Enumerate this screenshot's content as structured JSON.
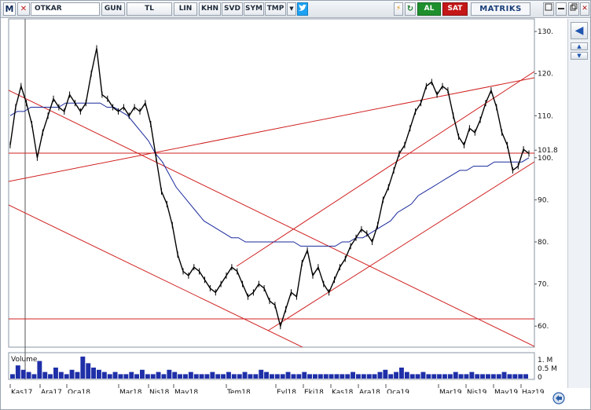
{
  "toolbar": {
    "logo": "M",
    "symbol": "OTKAR",
    "period": "GUN",
    "currency": "TL",
    "scale": "LIN",
    "khn": "KHN",
    "svd": "SVD",
    "sym": "SYM",
    "tmp": "TMP",
    "dropdown": "▼",
    "al": "AL",
    "sat": "SAT",
    "brand": "MATRIKS",
    "close": "✕"
  },
  "right_strip": {
    "up": "▲",
    "down": "▼",
    "arrow": "◀"
  },
  "chart_data": {
    "type": "line",
    "price_axis": {
      "labels": [
        "130.",
        "120.",
        "110.",
        "101.8",
        "100.",
        "90.",
        "80.",
        "70.",
        "60."
      ],
      "range": [
        55,
        133
      ]
    },
    "volume_axis": {
      "title": "Volume",
      "labels": [
        "1. M",
        "0.5 M",
        "0"
      ]
    },
    "x_axis": {
      "labels": [
        "Kas17",
        "Ara17",
        "Oca18",
        "Mar18",
        "Nis18",
        "May18",
        "Tem18",
        "Eyl18",
        "Eki18",
        "Kas18",
        "Ara18",
        "Oca19",
        "Mar19",
        "Nis19",
        "May19",
        "Haz19"
      ]
    },
    "last_price": 101.8,
    "price_series": [
      103,
      112,
      117,
      113,
      108,
      100,
      106,
      110,
      114,
      112,
      111,
      115,
      113,
      111,
      113,
      120,
      126,
      115,
      114,
      112,
      111,
      112,
      110,
      112,
      111,
      113,
      108,
      100,
      92,
      89,
      84,
      77,
      73,
      72,
      74,
      73,
      71,
      69,
      68,
      70,
      72,
      74,
      73,
      70,
      67,
      68,
      70,
      69,
      66,
      65,
      60,
      64,
      68,
      67,
      75,
      78,
      72,
      74,
      70,
      68,
      71,
      74,
      76,
      79,
      81,
      83,
      82,
      80,
      84,
      90,
      93,
      97,
      101,
      103,
      107,
      111,
      113,
      117,
      118,
      115,
      117,
      116,
      110,
      105,
      103,
      107,
      106,
      109,
      113,
      116,
      112,
      106,
      103,
      97,
      98,
      102,
      101
    ],
    "ma_series": [
      110,
      111,
      111,
      112,
      112,
      112,
      112,
      112,
      113,
      113,
      113,
      113,
      113,
      113,
      112,
      112,
      111,
      110,
      108,
      106,
      104,
      101,
      99,
      96,
      93,
      91,
      89,
      87,
      85,
      84,
      83,
      82,
      81,
      81,
      80,
      80,
      80,
      80,
      80,
      80,
      80,
      80,
      79,
      79,
      79,
      79,
      79,
      79,
      80,
      80,
      81,
      81,
      82,
      83,
      84,
      85,
      87,
      88,
      89,
      91,
      92,
      93,
      94,
      95,
      96,
      97,
      97,
      98,
      98,
      98,
      99,
      99,
      99,
      99,
      99,
      100
    ],
    "volume_series": [
      0.2,
      0.6,
      0.4,
      0.3,
      0.2,
      0.8,
      0.3,
      0.2,
      0.5,
      0.3,
      0.2,
      0.4,
      0.3,
      1.0,
      0.7,
      0.5,
      0.4,
      0.3,
      0.2,
      0.3,
      0.2,
      0.2,
      0.3,
      0.2,
      0.4,
      0.2,
      0.2,
      0.3,
      0.2,
      0.4,
      0.3,
      0.2,
      0.2,
      0.3,
      0.2,
      0.2,
      0.2,
      0.3,
      0.2,
      0.2,
      0.3,
      0.2,
      0.2,
      0.3,
      0.2,
      0.2,
      0.4,
      0.3,
      0.2,
      0.2,
      0.2,
      0.3,
      0.2,
      0.2,
      0.3,
      0.2,
      0.2,
      0.2,
      0.2,
      0.2,
      0.2,
      0.2,
      0.2,
      0.3,
      0.2,
      0.2,
      0.2,
      0.2,
      0.3,
      0.4,
      0.2,
      0.3,
      0.5,
      0.3,
      0.2,
      0.2,
      0.3,
      0.2,
      0.2,
      0.2,
      0.2,
      0.2,
      0.3,
      0.2,
      0.2,
      0.3,
      0.2,
      0.2,
      0.2,
      0.2,
      0.2,
      0.3,
      0.2,
      0.2,
      0.2,
      0.2
    ]
  }
}
